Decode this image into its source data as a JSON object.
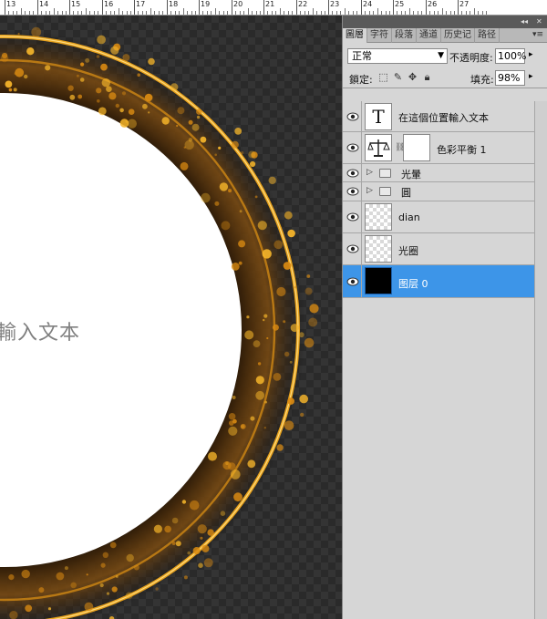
{
  "ruler": {
    "labels": [
      "13",
      "14",
      "15",
      "16",
      "17",
      "18",
      "19",
      "20",
      "21",
      "22",
      "23",
      "24",
      "25",
      "26",
      "27"
    ]
  },
  "canvas": {
    "text": "輸入文本"
  },
  "panel": {
    "tabs": [
      "圖層",
      "字符",
      "段落",
      "通道",
      "历史记",
      "路径"
    ],
    "blend_mode": "正常",
    "opacity_label": "不透明度:",
    "opacity_value": "100%",
    "lock_label": "鎖定:",
    "fill_label": "填充:",
    "fill_value": "98%",
    "layers": [
      {
        "name": "在這個位置輸入文本",
        "type": "text",
        "thumb_glyph": "T"
      },
      {
        "name": "色彩平衡 1",
        "type": "adjustment"
      },
      {
        "name": "光暈",
        "type": "group"
      },
      {
        "name": "圓",
        "type": "group"
      },
      {
        "name": "dian",
        "type": "pixel"
      },
      {
        "name": "光圈",
        "type": "pixel"
      },
      {
        "name": "图层 0",
        "type": "pixel-black",
        "selected": true
      }
    ]
  },
  "colors": {
    "selection": "#3d95e8",
    "glow": "#f0a818",
    "panel_bg": "#d6d6d6"
  }
}
